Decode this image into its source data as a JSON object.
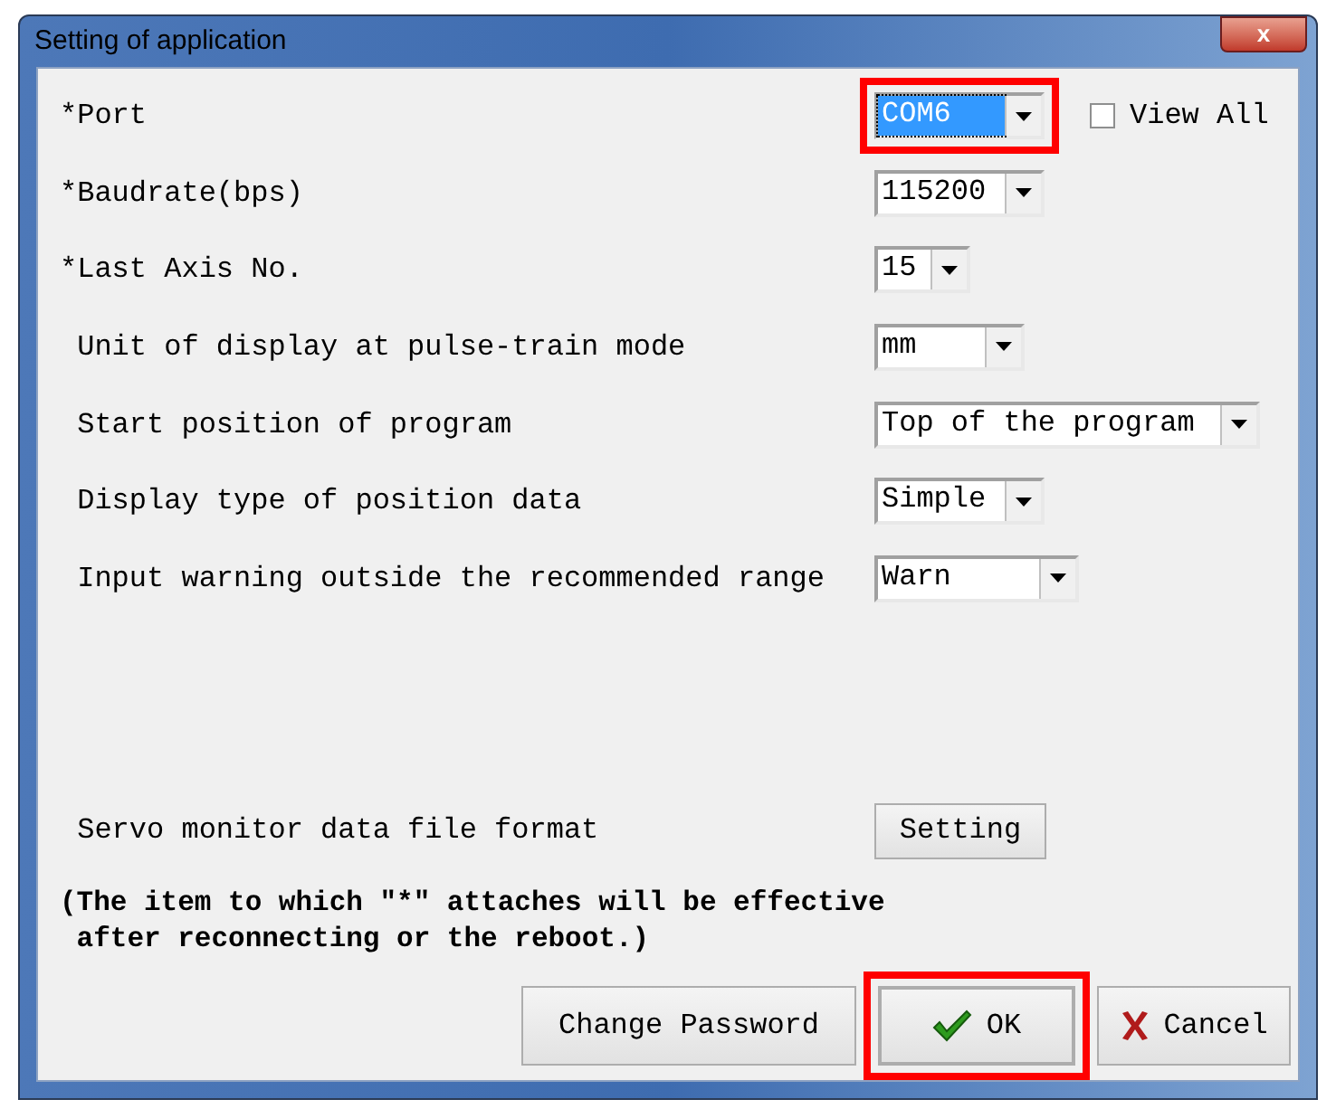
{
  "window": {
    "title": "Setting of application",
    "close": "x"
  },
  "settings": [
    {
      "label": "*Port",
      "value": "COM6",
      "focused": true,
      "highlighted": true
    },
    {
      "label": "*Baudrate(bps)",
      "value": "115200",
      "focused": false,
      "highlighted": false
    },
    {
      "label": "*Last Axis No.",
      "value": "15",
      "focused": false,
      "highlighted": false
    },
    {
      "label": " Unit of display at pulse-train mode",
      "value": "mm",
      "focused": false,
      "highlighted": false
    },
    {
      "label": " Start position of program",
      "value": "Top of the program",
      "focused": false,
      "highlighted": false
    },
    {
      "label": " Display type of position data",
      "value": "Simple",
      "focused": false,
      "highlighted": false
    },
    {
      "label": " Input warning outside the recommended range",
      "value": "Warn",
      "focused": false,
      "highlighted": false
    }
  ],
  "view_all": {
    "label": "View All",
    "checked": false
  },
  "servo_monitor": {
    "label": " Servo monitor data file format",
    "button": "Setting"
  },
  "note": "(The item to which \"*\" attaches will be effective\n after reconnecting or the reboot.)",
  "buttons": [
    {
      "kind": "plain",
      "label": "Change Password",
      "highlighted": false
    },
    {
      "kind": "ok",
      "label": "OK",
      "highlighted": true
    },
    {
      "kind": "cancel",
      "label": "Cancel",
      "highlighted": false
    }
  ]
}
